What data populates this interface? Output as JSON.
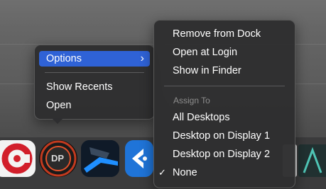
{
  "context_menu": {
    "items": [
      {
        "label": "Options",
        "submenu_arrow": "›"
      },
      {
        "label": "Show Recents"
      },
      {
        "label": "Open"
      }
    ]
  },
  "options_submenu": {
    "items": [
      {
        "label": "Remove from Dock"
      },
      {
        "label": "Open at Login"
      },
      {
        "label": "Show in Finder"
      }
    ],
    "section_title": "Assign To",
    "assign_items": [
      {
        "label": "All Desktops"
      },
      {
        "label": "Desktop on Display 1"
      },
      {
        "label": "Desktop on Display 2"
      },
      {
        "label": "None",
        "check": "✓"
      }
    ]
  },
  "dock": {
    "apps": [
      {
        "name": "cubase-icon"
      },
      {
        "name": "digital-performer-icon",
        "badge": "DP"
      },
      {
        "name": "final-cut-style-icon"
      },
      {
        "name": "logic-style-icon"
      },
      {
        "name": "blank-app-icon"
      },
      {
        "name": "teal-app-icon"
      }
    ]
  },
  "colors": {
    "menu_bg": "#2e2e30",
    "highlight": "#2f62d6",
    "section_text": "#8e8e8e"
  }
}
